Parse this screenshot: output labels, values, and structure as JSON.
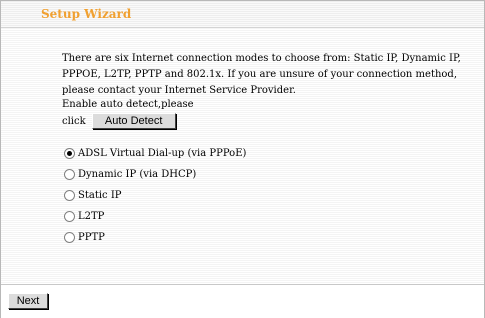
{
  "wizard": {
    "title": "Setup Wizard",
    "description": "There are six Internet connection modes to choose from: Static IP, Dynamic IP, PPPOE, L2TP, PPTP and 802.1x. If you are unsure of your connection method, please contact your Internet Service Provider.",
    "auto_detect_label": "Enable auto detect,please",
    "click_text": "click",
    "auto_detect_button": "Auto Detect",
    "options": [
      {
        "label": "ADSL Virtual Dial-up (via PPPoE)",
        "selected": true
      },
      {
        "label": "Dynamic IP (via DHCP)",
        "selected": false
      },
      {
        "label": "Static IP",
        "selected": false
      },
      {
        "label": "L2TP",
        "selected": false
      },
      {
        "label": "PPTP",
        "selected": false
      }
    ],
    "next_button": "Next"
  },
  "colors": {
    "title": "#f0a030",
    "text": "#000000",
    "button_face": "#dcdcdc"
  }
}
